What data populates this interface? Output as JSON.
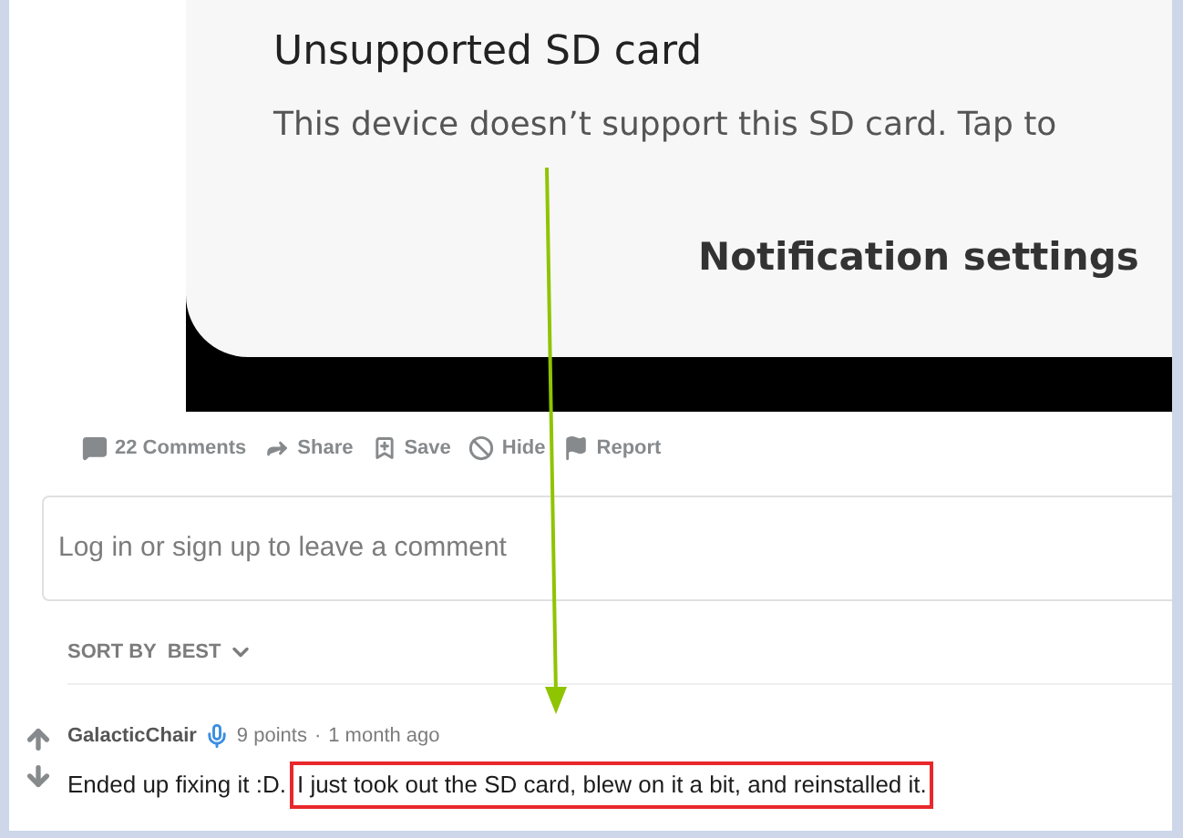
{
  "screenshot": {
    "title": "Unsupported SD card",
    "message": "This device doesn’t support this SD card. Tap to",
    "button": "Notification settings"
  },
  "actions": [
    {
      "kind": "comments",
      "label": "22 Comments"
    },
    {
      "kind": "share",
      "label": "Share"
    },
    {
      "kind": "save",
      "label": "Save"
    },
    {
      "kind": "hide",
      "label": "Hide"
    },
    {
      "kind": "report",
      "label": "Report"
    }
  ],
  "comment_box": {
    "placeholder": "Log in or sign up to leave a comment"
  },
  "sort": {
    "label": "SORT BY",
    "value": "BEST"
  },
  "comment": {
    "author": "GalacticChair",
    "points": "9 points",
    "separator": "·",
    "age": "1 month ago",
    "segments": [
      {
        "text": "Ended up fixing it :D.",
        "highlighted": false
      },
      {
        "text": "I just took out the SD card, blew on it a bit, and reinstalled it.",
        "highlighted": true
      }
    ]
  }
}
